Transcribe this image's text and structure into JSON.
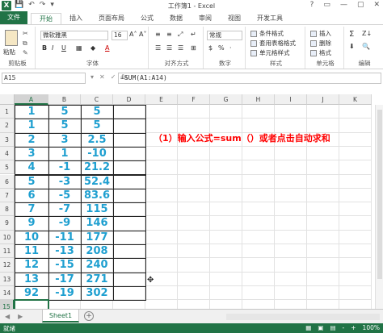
{
  "titlebar": {
    "title": "工作簿1 - Excel",
    "logo": "X",
    "qat": [
      "💾",
      "↶",
      "↷",
      "▾"
    ],
    "controls": [
      "?",
      "▭",
      "—",
      "▢",
      "✕"
    ]
  },
  "ribbon_tabs": [
    "文件",
    "开始",
    "插入",
    "页面布局",
    "公式",
    "数据",
    "审阅",
    "视图",
    "开发工具"
  ],
  "ribbon": {
    "clipboard": {
      "paste": "粘贴",
      "label": "剪贴板"
    },
    "font": {
      "name": "微软雅黑",
      "size": "16",
      "grow": "A˄",
      "shrink": "A˅",
      "bold": "B",
      "italic": "I",
      "underline": "U",
      "fill": "A",
      "label": "字体"
    },
    "alignment": {
      "label": "对齐方式"
    },
    "number": {
      "format": "常规",
      "currency": "$",
      "percent": "%",
      "comma": "·",
      "label": "数字"
    },
    "styles": {
      "items": [
        "条件格式",
        "套用表格格式",
        "单元格样式"
      ],
      "label": "样式"
    },
    "cells": {
      "items": [
        "插入",
        "删除",
        "格式"
      ],
      "label": "单元格"
    },
    "editing": {
      "sum": "Σ",
      "sort": "Z↓",
      "find": "🔍",
      "label": "编辑"
    }
  },
  "formula_bar": {
    "namebox": "A15",
    "icons": [
      "▾",
      "✕",
      "✓",
      "fx"
    ],
    "formula": "=SUM(A1:A14)"
  },
  "columns": [
    "A",
    "B",
    "C",
    "D",
    "E",
    "F",
    "G",
    "H",
    "I",
    "J",
    "K"
  ],
  "rows": [
    "1",
    "2",
    "3",
    "4",
    "5",
    "6",
    "7",
    "8",
    "9",
    "10",
    "11",
    "12",
    "13",
    "14",
    "15"
  ],
  "data": {
    "A": [
      "1",
      "1",
      "2",
      "3",
      "4",
      "5",
      "6",
      "7",
      "9",
      "10",
      "11",
      "12",
      "13",
      "92"
    ],
    "B": [
      "5",
      "5",
      "3",
      "1",
      "-1",
      "-3",
      "-5",
      "-7",
      "-9",
      "-11",
      "-13",
      "-15",
      "-17",
      "-19"
    ],
    "C": [
      "5",
      "5",
      "2.5",
      "-10",
      "21.2",
      "52.4",
      "83.6",
      "115",
      "146",
      "177",
      "208",
      "240",
      "271",
      "302"
    ]
  },
  "instruction": "（1）输入公式=sum（）或者点击自动求和",
  "sheet": {
    "name": "Sheet1",
    "add": "+",
    "nav": [
      "◀",
      "▶"
    ]
  },
  "status": {
    "ready": "就绪",
    "zoom": "100%",
    "view_icons": [
      "▦",
      "▣",
      "▤"
    ],
    "zoom_controls": [
      "-",
      "+"
    ]
  },
  "colors": {
    "accent": "#217346",
    "data_text": "#1e9fd0",
    "instruction": "#ff0000"
  }
}
